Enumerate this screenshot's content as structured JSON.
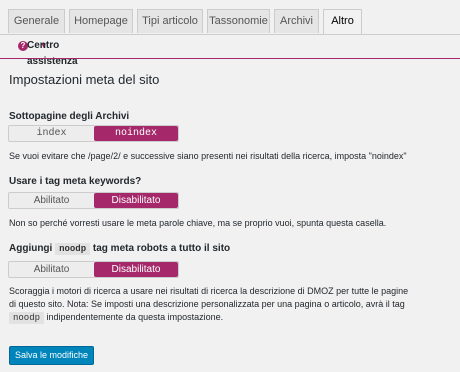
{
  "tabs": [
    {
      "label": "Generale"
    },
    {
      "label": "Homepage"
    },
    {
      "label": "Tipi articolo"
    },
    {
      "label": "Tassonomie"
    },
    {
      "label": "Archivi"
    },
    {
      "label": "Altro"
    }
  ],
  "active_tab": "Altro",
  "help": {
    "label": "Centro assistenza",
    "icon": "question-icon"
  },
  "section_title": "Impostazioni meta del sito",
  "subpages": {
    "label": "Sottopagine degli Archivi",
    "options": [
      "index",
      "noindex"
    ],
    "selected": "noindex",
    "description": "Se vuoi evitare che /page/2/ e successive siano presenti nei risultati della ricerca, imposta \"noindex\""
  },
  "keywords": {
    "label": "Usare i tag meta keywords?",
    "options": [
      "Abilitato",
      "Disabilitato"
    ],
    "selected": "Disabilitato",
    "description": "Non so perché vorresti usare le meta parole chiave, ma se proprio vuoi, spunta questa casella."
  },
  "noodp": {
    "label_before": "Aggiungi",
    "code": "noodp",
    "label_after": "tag meta robots a tutto il sito",
    "options": [
      "Abilitato",
      "Disabilitato"
    ],
    "selected": "Disabilitato",
    "description_line1": "Scoraggia i motori di ricerca a usare nei risultati di ricerca la descrizione di DMOZ per tutte le pagine",
    "description_line2": "di questo sito. Nota: Se imposti una descrizione personalizzata per una pagina o articolo, avrà il tag",
    "description_line3_after": "indipendentemente da questa impostazione."
  },
  "save_button": "Salva le modifiche",
  "colors": {
    "accent": "#a4286a",
    "primary_button": "#0085ba",
    "background": "#f1f1f1"
  }
}
